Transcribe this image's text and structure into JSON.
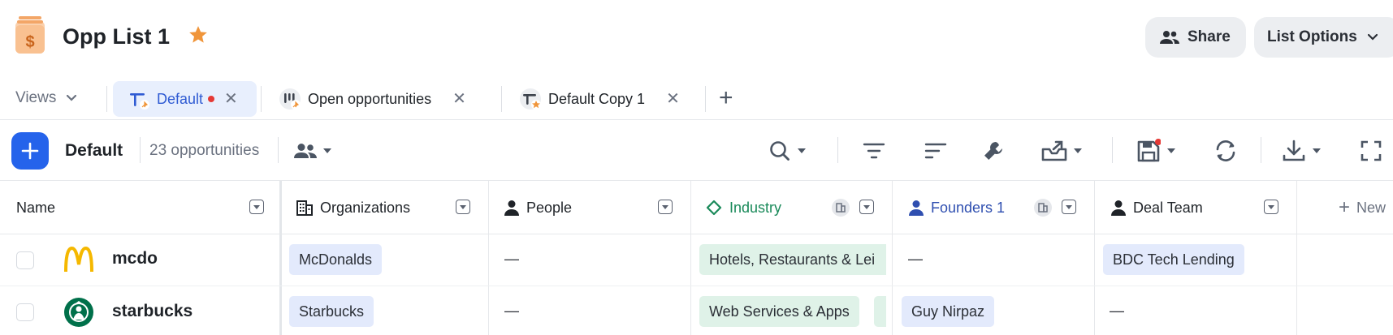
{
  "header": {
    "title": "Opp List 1",
    "share_label": "Share",
    "list_options_label": "List Options"
  },
  "views": {
    "dropdown_label": "Views",
    "tabs": [
      {
        "label": "Default",
        "active": true,
        "unsaved": true
      },
      {
        "label": "Open opportunities",
        "active": false
      },
      {
        "label": "Default Copy 1",
        "active": false
      }
    ]
  },
  "toolbar": {
    "view_name": "Default",
    "count_text": "23 opportunities"
  },
  "table": {
    "columns": [
      {
        "label": "Name"
      },
      {
        "label": "Organizations"
      },
      {
        "label": "People"
      },
      {
        "label": "Industry"
      },
      {
        "label": "Founders 1"
      },
      {
        "label": "Deal Team"
      }
    ],
    "new_column_label": "New",
    "empty_value": "—",
    "rows": [
      {
        "name": "mcdo",
        "logo": "mcdonalds-logo",
        "organization": "McDonalds",
        "people": "—",
        "industry": "Hotels, Restaurants & Lei",
        "founders": "—",
        "deal_team": "BDC Tech Lending"
      },
      {
        "name": "starbucks",
        "logo": "starbucks-logo",
        "organization": "Starbucks",
        "people": "—",
        "industry": "Web Services & Apps",
        "founders": "Guy Nirpaz",
        "deal_team": "—"
      }
    ]
  },
  "colors": {
    "accent": "#2563eb",
    "industry_header": "#1a8a5a",
    "founders_header": "#2f4fb0",
    "star": "#f0953a"
  }
}
